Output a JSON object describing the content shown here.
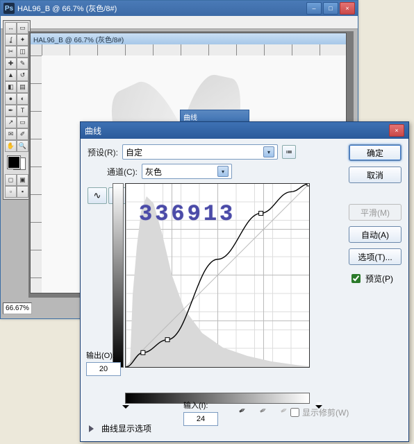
{
  "ps_window": {
    "app_icon_text": "Ps",
    "title": "HAL96_B @ 66.7% (灰色/8#)",
    "doc_title": "HAL96_B @ 66.7% (灰色/8#)",
    "zoom_pct": "66.67%"
  },
  "curves": {
    "mini_title": "曲线",
    "title": "曲线",
    "preset_label": "预设(R):",
    "preset_value": "自定",
    "channel_label": "通道(C):",
    "channel_value": "灰色",
    "output_label": "输出(O):",
    "output_value": "20",
    "input_label": "输入(I):",
    "input_value": "24",
    "show_clip_label": "显示修剪(W)",
    "disclosure_label": "曲线显示选项",
    "buttons": {
      "ok": "确定",
      "cancel": "取消",
      "smooth": "平滑(M)",
      "auto": "自动(A)",
      "options": "选项(T)...",
      "preview": "预览(P)"
    }
  },
  "overlay_number": "336913",
  "chart_data": {
    "type": "line",
    "title": "曲线",
    "xlabel": "输入",
    "ylabel": "输出",
    "xlim": [
      0,
      255
    ],
    "ylim": [
      0,
      255
    ],
    "series": [
      {
        "name": "baseline",
        "x": [
          0,
          255
        ],
        "y": [
          0,
          255
        ]
      },
      {
        "name": "curve",
        "x": [
          0,
          24,
          58,
          128,
          188,
          230,
          255
        ],
        "y": [
          0,
          20,
          38,
          150,
          214,
          244,
          255
        ]
      }
    ],
    "handles": [
      {
        "x": 24,
        "y": 20
      },
      {
        "x": 58,
        "y": 38
      },
      {
        "x": 188,
        "y": 214
      },
      {
        "x": 255,
        "y": 255
      }
    ],
    "histogram_peak_x": 30,
    "histogram_shape": "heavy-left-tail"
  }
}
